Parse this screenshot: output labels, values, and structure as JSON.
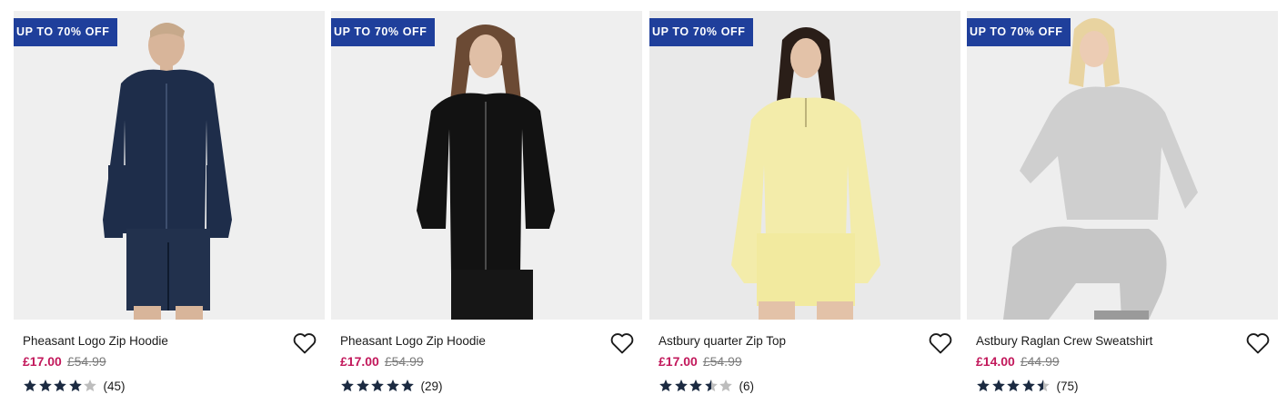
{
  "colors": {
    "badge": "#1f3f9b",
    "sale_price": "#c2185b",
    "star_filled": "#1b2a41",
    "star_empty": "#bdbdbd"
  },
  "products": [
    {
      "badge": "UP TO 70% OFF",
      "title": "Pheasant Logo Zip Hoodie",
      "price": "£17.00",
      "was": "£54.99",
      "rating": 4,
      "count": "(45)",
      "wishlist_icon": "heart-outline-icon"
    },
    {
      "badge": "UP TO 70% OFF",
      "title": "Pheasant Logo Zip Hoodie",
      "price": "£17.00",
      "was": "£54.99",
      "rating": 5,
      "count": "(29)",
      "wishlist_icon": "heart-outline-icon"
    },
    {
      "badge": "UP TO 70% OFF",
      "title": "Astbury quarter Zip Top",
      "price": "£17.00",
      "was": "£54.99",
      "rating": 3.5,
      "count": "(6)",
      "wishlist_icon": "heart-outline-icon"
    },
    {
      "badge": "UP TO 70% OFF",
      "title": "Astbury Raglan Crew Sweatshirt",
      "price": "£14.00",
      "was": "£44.99",
      "rating": 4.5,
      "count": "(75)",
      "wishlist_icon": "heart-outline-icon"
    }
  ]
}
